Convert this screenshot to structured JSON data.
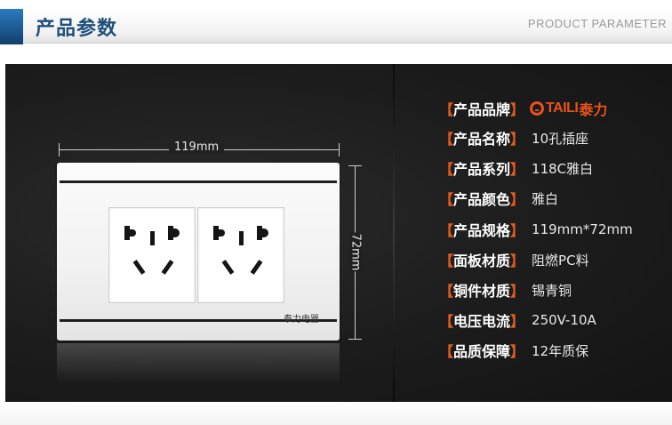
{
  "header": {
    "title": "产品参数",
    "subtitle": "PRODUCT PARAMETER"
  },
  "colors": {
    "header_accent": "#1f4f7a",
    "panel_bg": "#1c1c1c",
    "bracket": "#e25a1c",
    "brand": "#e8521a"
  },
  "dimensions": {
    "width_label": "119mm",
    "height_label": "72mm"
  },
  "plate": {
    "brand_text": "泰力电器"
  },
  "brand": {
    "logo_text": "TAILI",
    "logo_cn": "泰力",
    "icon": "taili-logo-icon"
  },
  "specs": [
    {
      "label": "产品品牌",
      "value": ""
    },
    {
      "label": "产品名称",
      "value": "10孔插座"
    },
    {
      "label": "产品系列",
      "value": "118C雅白"
    },
    {
      "label": "产品颜色",
      "value": "雅白"
    },
    {
      "label": "产品规格",
      "value": "119mm*72mm"
    },
    {
      "label": "面板材质",
      "value": "阻燃PC料"
    },
    {
      "label": "铜件材质",
      "value": "锡青铜"
    },
    {
      "label": "电压电流",
      "value": "250V-10A"
    },
    {
      "label": "品质保障",
      "value": "12年质保"
    }
  ],
  "brackets": {
    "open": "【",
    "close": "】"
  }
}
